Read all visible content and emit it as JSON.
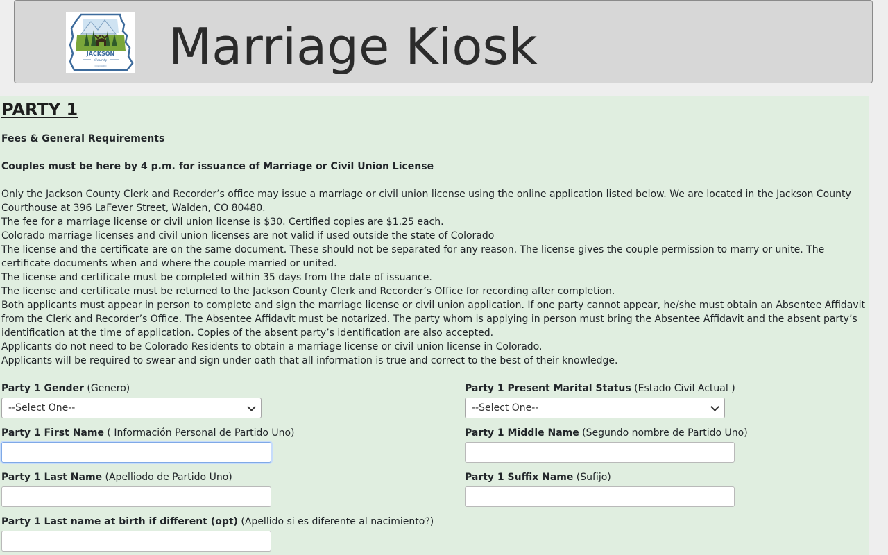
{
  "header": {
    "title": "Marriage Kiosk",
    "logo": {
      "name": "jackson-county-logo",
      "text_main": "JACKSON",
      "text_sub": "County",
      "text_small": "COLORADO"
    }
  },
  "colors": {
    "header_bg": "#d7d7d7",
    "content_bg": "#e0eee0",
    "page_bg": "#eeeeee",
    "logo_green": "#7aa63a",
    "logo_blue": "#3d6b9c"
  },
  "section": {
    "heading": "PARTY 1",
    "fees_heading": "Fees & General Requirements",
    "deadline": "Couples must be here by 4 p.m. for issuance of Marriage or Civil Union License",
    "paragraphs": [
      "Only the Jackson County Clerk and Recorder’s office may issue a marriage or civil union license using the online application listed below. We are located in the Jackson County Courthouse at 396 LaFever Street, Walden, CO 80480.",
      "The fee for a marriage license or civil union license is $30. Certified copies are $1.25 each.",
      "Colorado marriage licenses and civil union licenses are not valid if used outside the state of Colorado",
      "The license and the certificate are on the same document. These should not be separated for any reason. The license gives the couple permission to marry or unite. The certificate documents when and where the couple married or united.",
      "The license and certificate must be completed within 35 days from the date of issuance.",
      "The license and certificate must be returned to the Jackson County Clerk and Recorder’s Office for recording after completion.",
      "Both applicants must appear in person to complete and sign the marriage license or civil union application. If one party cannot appear, he/she must obtain an Absentee Affidavit from the Clerk and Recorder’s Office. The Absentee Affidavit must be notarized. The party whom is applying in person must bring the Absentee Affidavit and the absent party’s identification at the time of application. Copies of the absent party’s identification are also accepted.",
      "Applicants do not need to be Colorado Residents to obtain a marriage license or civil union license in Colorado.",
      "Applicants will be required to swear and sign under oath that all information is true and correct to the best of their knowledge."
    ]
  },
  "form": {
    "gender": {
      "label": "Party 1 Gender",
      "translation": " (Genero)",
      "selected": "--Select One--"
    },
    "marital_status": {
      "label": "Party 1 Present Marital Status",
      "translation": " (Estado Civil Actual )",
      "selected": "--Select One--"
    },
    "first_name": {
      "label": "Party 1 First Name",
      "translation": " ( Información Personal de Partido Uno)",
      "value": ""
    },
    "middle_name": {
      "label": "Party 1 Middle Name",
      "translation": " (Segundo nombre de Partido Uno)",
      "value": ""
    },
    "last_name": {
      "label": "Party 1 Last Name",
      "translation": " (Apelliodo de Partido Uno)",
      "value": ""
    },
    "suffix_name": {
      "label": "Party 1 Suffix Name",
      "translation": " (Sufijo)",
      "value": ""
    },
    "birth_last_name": {
      "label": "Party 1 Last name at birth if different (opt)",
      "translation": " (Apellido si es diferente al nacimiento?)",
      "value": ""
    }
  }
}
